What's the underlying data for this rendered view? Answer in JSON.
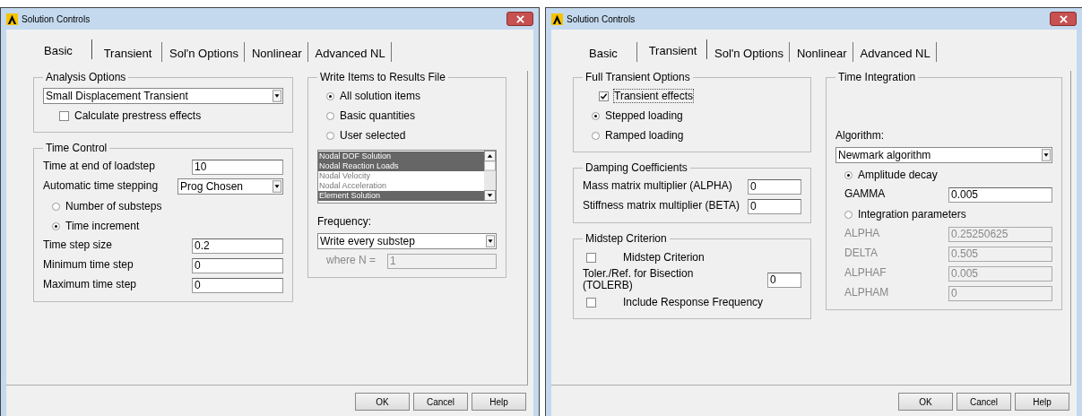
{
  "dialogs": [
    {
      "title": "Solution Controls",
      "tabs": [
        {
          "label": "Basic",
          "selected": true
        },
        {
          "label": "Transient",
          "selected": false
        },
        {
          "label": "Sol'n Options",
          "selected": false
        },
        {
          "label": "Nonlinear",
          "selected": false
        },
        {
          "label": "Advanced NL",
          "selected": false
        }
      ],
      "columns": [
        [
          {
            "title": "Analysis Options",
            "items": [
              {
                "kind": "dropdown",
                "value": "Small Displacement Transient"
              },
              {
                "kind": "checkbox",
                "label": "Calculate prestress effects",
                "checked": false
              }
            ]
          },
          {
            "title": "Time Control",
            "items": [
              {
                "kind": "field",
                "label": "Time at end of loadstep",
                "value": "10",
                "disabled": false
              },
              {
                "kind": "dropdown",
                "label": "Automatic time stepping",
                "value": "Prog Chosen"
              },
              {
                "kind": "radio",
                "label": "Number of substeps",
                "selected": false
              },
              {
                "kind": "radio",
                "label": "Time increment",
                "selected": true
              },
              {
                "kind": "field",
                "label": "Time step size",
                "value": "0.2",
                "disabled": false
              },
              {
                "kind": "field",
                "label": "Minimum time step",
                "value": "0",
                "disabled": false
              },
              {
                "kind": "field",
                "label": "Maximum time step",
                "value": "0",
                "disabled": false
              }
            ]
          }
        ],
        [
          {
            "title": "Write Items to Results File",
            "items": [
              {
                "kind": "radio",
                "label": "All solution items",
                "selected": true
              },
              {
                "kind": "radio",
                "label": "Basic quantities",
                "selected": false
              },
              {
                "kind": "radio",
                "label": "User selected",
                "selected": false
              },
              {
                "kind": "listbox",
                "options": [
                  {
                    "label": "Nodal DOF Solution",
                    "selected": true
                  },
                  {
                    "label": "Nodal Reaction Loads",
                    "selected": true
                  },
                  {
                    "label": "Nodal Velocity",
                    "selected": false
                  },
                  {
                    "label": "Nodal Acceleration",
                    "selected": false
                  },
                  {
                    "label": "Element Solution",
                    "selected": true
                  }
                ]
              },
              {
                "kind": "label",
                "label": "Frequency:"
              },
              {
                "kind": "dropdown",
                "value": "Write every substep"
              },
              {
                "kind": "field",
                "label": "where N =",
                "value": "1",
                "disabled": true
              }
            ]
          }
        ]
      ],
      "buttons": [
        "OK",
        "Cancel",
        "Help"
      ]
    },
    {
      "title": "Solution Controls",
      "tabs": [
        {
          "label": "Basic",
          "selected": false
        },
        {
          "label": "Transient",
          "selected": true
        },
        {
          "label": "Sol'n Options",
          "selected": false
        },
        {
          "label": "Nonlinear",
          "selected": false
        },
        {
          "label": "Advanced NL",
          "selected": false
        }
      ],
      "columns": [
        [
          {
            "title": "Full Transient Options",
            "items": [
              {
                "kind": "checkbox",
                "label": "Transient effects",
                "checked": true
              },
              {
                "kind": "radio",
                "label": "Stepped loading",
                "selected": true
              },
              {
                "kind": "radio",
                "label": "Ramped loading",
                "selected": false
              }
            ]
          },
          {
            "title": "Damping Coefficients",
            "items": [
              {
                "kind": "field",
                "label": "Mass matrix multiplier (ALPHA)",
                "value": "0",
                "disabled": false
              },
              {
                "kind": "field",
                "label": "Stiffness matrix multiplier (BETA)",
                "value": "0",
                "disabled": false
              }
            ]
          },
          {
            "title": "Midstep Criterion",
            "items": [
              {
                "kind": "checkbox",
                "label": "Midstep Criterion",
                "checked": false
              },
              {
                "kind": "field",
                "label": "Toler./Ref. for Bisection\n(TOLERB)",
                "value": "0",
                "disabled": false
              },
              {
                "kind": "checkbox",
                "label": "Include Response Frequency",
                "checked": false
              }
            ]
          }
        ],
        [
          {
            "title": "Time Integration",
            "items": [
              {
                "kind": "label",
                "label": "Algorithm:"
              },
              {
                "kind": "dropdown",
                "value": "Newmark algorithm"
              },
              {
                "kind": "radio",
                "label": "Amplitude decay",
                "selected": true
              },
              {
                "kind": "field",
                "label": "GAMMA",
                "value": "0.005",
                "disabled": false
              },
              {
                "kind": "radio",
                "label": "Integration parameters",
                "selected": false
              },
              {
                "kind": "field",
                "label": "ALPHA",
                "value": "0.25250625",
                "disabled": true
              },
              {
                "kind": "field",
                "label": "DELTA",
                "value": "0.505",
                "disabled": true
              },
              {
                "kind": "field",
                "label": "ALPHAF",
                "value": "0.005",
                "disabled": true
              },
              {
                "kind": "field",
                "label": "ALPHAM",
                "value": "0",
                "disabled": true
              }
            ]
          }
        ]
      ],
      "buttons": [
        "OK",
        "Cancel",
        "Help"
      ]
    }
  ]
}
